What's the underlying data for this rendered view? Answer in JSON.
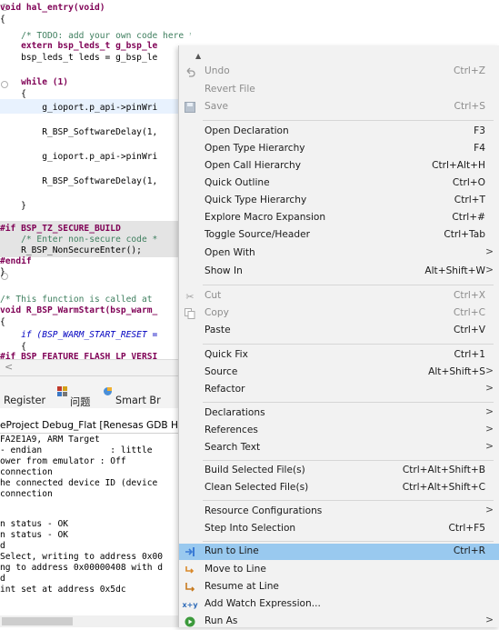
{
  "editor": {
    "lines": [
      "void hal_entry(void)",
      "{",
      "    /* TODO: add your own code here */",
      "    extern bsp_leds_t g_bsp_le",
      "    bsp_leds_t leds = g_bsp_le",
      "",
      "    while (1)",
      "    {",
      "        g_ioport.p_api->pinWri",
      "",
      "        R_BSP_SoftwareDelay(1,",
      "",
      "        g_ioport.p_api->pinWri",
      "",
      "        R_BSP_SoftwareDelay(1,",
      "",
      "    }",
      "#if BSP_TZ_SECURE_BUILD",
      "    /* Enter non-secure code *",
      "    R_BSP_NonSecureEnter();",
      "#endif",
      "}",
      "",
      "/* This function is called at",
      "void R_BSP_WarmStart(bsp_warm_",
      "{",
      "    if (BSP_WARM_START_RESET =",
      "    {",
      "#if BSP_FEATURE_FLASH_LP_VERSI"
    ]
  },
  "views_tabs": {
    "register": "Register",
    "problems": "问题",
    "smart_browser": "Smart Br"
  },
  "console": {
    "title": "eProject Debug_Flat [Renesas GDB Ha",
    "lines": [
      "FA2E1A9, ARM Target",
      "- endian             : little",
      "ower from emulator : Off",
      "connection",
      "he connected device ID (device",
      "connection",
      "",
      "n status - OK",
      "n status - OK",
      "d",
      "Select, writing to address 0x00",
      "ng to address 0x00000408 with d",
      "d",
      "int set at address 0x5dc"
    ]
  },
  "menu": {
    "undo": {
      "label": "Undo",
      "shortcut": "Ctrl+Z"
    },
    "revert_file": {
      "label": "Revert File"
    },
    "save": {
      "label": "Save",
      "shortcut": "Ctrl+S"
    },
    "open_declaration": {
      "label": "Open Declaration",
      "shortcut": "F3"
    },
    "open_type_hierarchy": {
      "label": "Open Type Hierarchy",
      "shortcut": "F4"
    },
    "open_call_hierarchy": {
      "label": "Open Call Hierarchy",
      "shortcut": "Ctrl+Alt+H"
    },
    "quick_outline": {
      "label": "Quick Outline",
      "shortcut": "Ctrl+O"
    },
    "quick_type_hierarchy": {
      "label": "Quick Type Hierarchy",
      "shortcut": "Ctrl+T"
    },
    "explore_macro_expansion": {
      "label": "Explore Macro Expansion",
      "shortcut": "Ctrl+#"
    },
    "toggle_source_header": {
      "label": "Toggle Source/Header",
      "shortcut": "Ctrl+Tab"
    },
    "open_with": {
      "label": "Open With",
      "arrow": ">"
    },
    "show_in": {
      "label": "Show In",
      "shortcut": "Alt+Shift+W",
      "arrow": ">"
    },
    "cut": {
      "label": "Cut",
      "shortcut": "Ctrl+X"
    },
    "copy": {
      "label": "Copy",
      "shortcut": "Ctrl+C"
    },
    "paste": {
      "label": "Paste",
      "shortcut": "Ctrl+V"
    },
    "quick_fix": {
      "label": "Quick Fix",
      "shortcut": "Ctrl+1"
    },
    "source": {
      "label": "Source",
      "shortcut": "Alt+Shift+S",
      "arrow": ">"
    },
    "refactor": {
      "label": "Refactor",
      "arrow": ">"
    },
    "declarations": {
      "label": "Declarations",
      "arrow": ">"
    },
    "references": {
      "label": "References",
      "arrow": ">"
    },
    "search_text": {
      "label": "Search Text",
      "arrow": ">"
    },
    "build_selected": {
      "label": "Build Selected File(s)",
      "shortcut": "Ctrl+Alt+Shift+B"
    },
    "clean_selected": {
      "label": "Clean Selected File(s)",
      "shortcut": "Ctrl+Alt+Shift+C"
    },
    "resource_configurations": {
      "label": "Resource Configurations",
      "arrow": ">"
    },
    "step_into_selection": {
      "label": "Step Into Selection",
      "shortcut": "Ctrl+F5"
    },
    "run_to_line": {
      "label": "Run to Line",
      "shortcut": "Ctrl+R"
    },
    "move_to_line": {
      "label": "Move to Line"
    },
    "resume_at_line": {
      "label": "Resume at Line"
    },
    "add_watch_expression": {
      "label": "Add Watch Expression..."
    },
    "run_as": {
      "label": "Run As",
      "arrow": ">"
    }
  },
  "colors": {
    "menu_bg": "#f2f2f2",
    "menu_highlight": "#99c9ef",
    "keyword": "#7f0055",
    "comment": "#3f7f5f"
  }
}
